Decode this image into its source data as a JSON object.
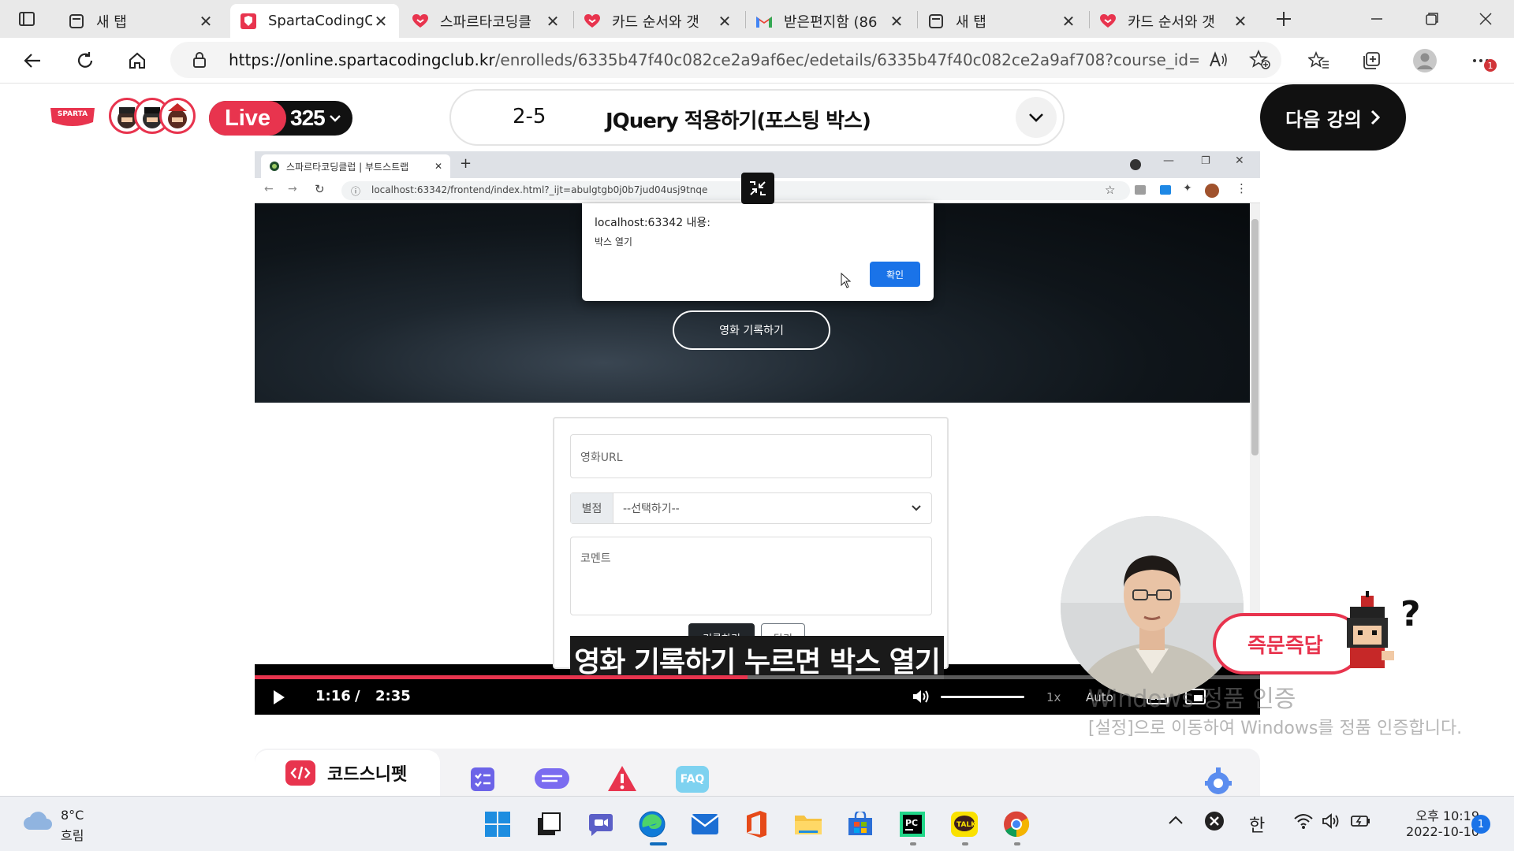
{
  "browser": {
    "tabs": [
      {
        "label": "새 탭",
        "icon": "new-tab-page-icon"
      },
      {
        "label": "SpartaCodingC",
        "icon": "sparta-favicon-icon",
        "active": true
      },
      {
        "label": "스파르타코딩클",
        "icon": "sparta-heart-icon"
      },
      {
        "label": "카드 순서와 갯",
        "icon": "sparta-heart-icon"
      },
      {
        "label": "받은편지함 (86",
        "icon": "gmail-icon"
      },
      {
        "label": "새 탭",
        "icon": "new-tab-page-icon"
      },
      {
        "label": "카드 순서와 갯",
        "icon": "sparta-heart-icon"
      }
    ],
    "address": {
      "url_host": "https://online.spartacodingclub.kr",
      "url_path": "/enrolleds/6335b47f40c082ce2a9af6ec/edetails/6335b47f40c082ce2a9af708?course_id=60a5ee4..."
    },
    "notification_badge": "1"
  },
  "course_header": {
    "logo_text": "SPARTA",
    "live_label": "Live",
    "live_count": "325",
    "lesson_number": "2-5",
    "lesson_title": "JQuery 적용하기(포스팅 박스)",
    "next_button": "다음 강의"
  },
  "video": {
    "inner_browser": {
      "tab_title": "스파르타코딩클럽 | 부트스트랩",
      "url": "localhost:63342/frontend/index.html?_ijt=abulgtgb0j0b7jud04usj9tnqe"
    },
    "dialog": {
      "title": "localhost:63342 내용:",
      "message": "박스 열기",
      "ok_label": "확인"
    },
    "hero_button": "영화 기록하기",
    "form": {
      "url_placeholder": "영화URL",
      "rating_label": "별점",
      "rating_value": "--선택하기--",
      "comment_placeholder": "코멘트",
      "save_button": "기록하기",
      "close_button": "닫기"
    },
    "caption": "영화 기록하기 누르면 박스 열기",
    "current_time": "1:16",
    "time_separator": "/",
    "duration": "2:35",
    "progress_fraction": 0.49,
    "volume_fraction": 1.0,
    "speed": "1x",
    "quality": "Auto"
  },
  "bottom_tabs": {
    "active_label": "코드스니펫",
    "others": [
      "checklist-icon",
      "chat-icon",
      "warning-icon",
      "faq-icon"
    ],
    "faq_label": "FAQ"
  },
  "floating": {
    "qa_button": "즉문즉답"
  },
  "watermark": {
    "title": "Windows 정품 인증",
    "line": "[설정]으로 이동하여 Windows를 정품 인증합니다."
  },
  "taskbar": {
    "weather_temp": "8°C",
    "weather_desc": "흐림",
    "ime": "한",
    "time": "오후 10:19",
    "date": "2022-10-10",
    "notifications": "1"
  },
  "colors": {
    "brand_red": "#e8344e",
    "chrome_bg": "#e9e9e9",
    "dialog_blue": "#1a73e8"
  }
}
